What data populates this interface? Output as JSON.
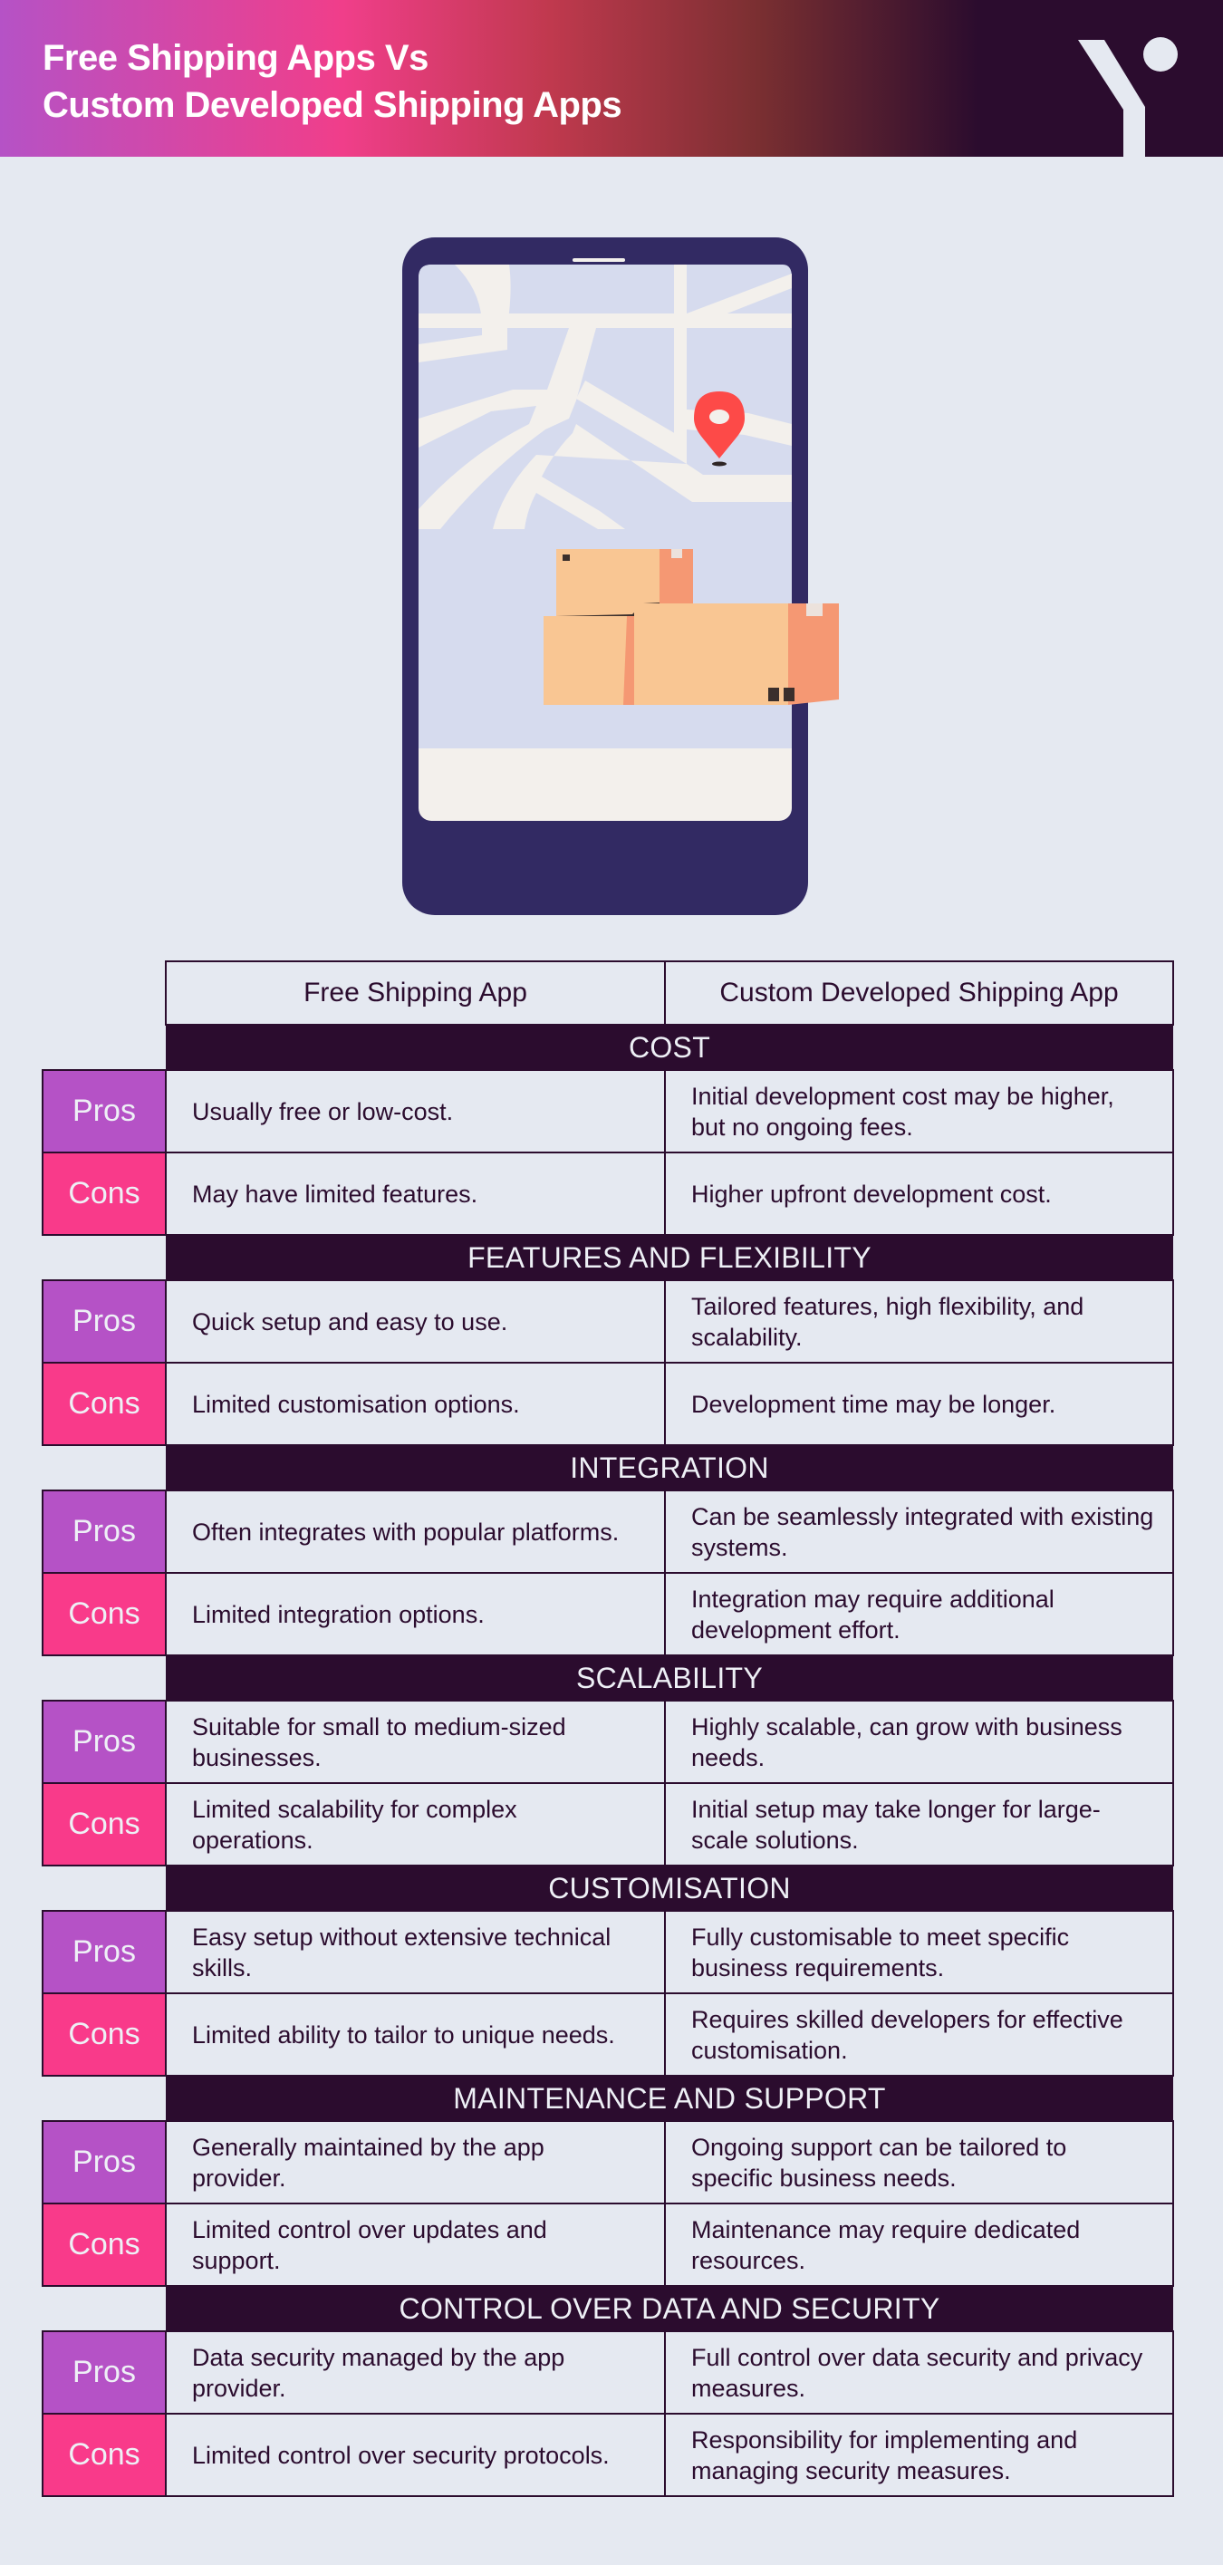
{
  "header": {
    "title_line1": "Free Shipping Apps Vs",
    "title_line2": "Custom Developed Shipping Apps",
    "logo_icon": "y-logo-mark"
  },
  "illustration": {
    "description": "smartphone-map-with-location-pin-and-parcel-boxes",
    "colors": {
      "phone": "#322a63",
      "map_bg": "#d6dbee",
      "roads": "#f3f0ec",
      "pin": "#fd4a48",
      "box_light": "#f9c693",
      "box_dark": "#f59873"
    }
  },
  "colors": {
    "pros": "#b552c6",
    "cons": "#f93a8a",
    "dark": "#2b0c2e",
    "background": "#e5e9f1"
  },
  "table": {
    "columns": [
      "Free Shipping App",
      "Custom Developed Shipping App"
    ],
    "pros_label": "Pros",
    "cons_label": "Cons",
    "sections": [
      {
        "title": "COST",
        "pros": [
          "Usually free or low-cost.",
          "Initial development cost may be higher, but no ongoing fees."
        ],
        "cons": [
          "May have limited features.",
          "Higher upfront development cost."
        ]
      },
      {
        "title": "FEATURES AND FLEXIBILITY",
        "pros": [
          "Quick setup and easy to use.",
          "Tailored features, high flexibility, and scalability."
        ],
        "cons": [
          "Limited customisation options.",
          "Development time may be longer."
        ]
      },
      {
        "title": "INTEGRATION",
        "pros": [
          "Often integrates with popular platforms.",
          "Can be seamlessly integrated with existing systems."
        ],
        "cons": [
          "Limited integration options.",
          "Integration may require additional development effort."
        ]
      },
      {
        "title": "SCALABILITY",
        "pros": [
          "Suitable for small to medium-sized businesses.",
          "Highly scalable, can grow with business needs."
        ],
        "cons": [
          "Limited scalability for complex operations.",
          "Initial setup may take longer for large-scale solutions."
        ]
      },
      {
        "title": "CUSTOMISATION",
        "pros": [
          "Easy setup without extensive technical skills.",
          "Fully customisable to meet specific business requirements."
        ],
        "cons": [
          "Limited ability to tailor to unique needs.",
          "Requires skilled developers for effective customisation."
        ]
      },
      {
        "title": "MAINTENANCE AND SUPPORT",
        "pros": [
          "Generally maintained by the app provider.",
          "Ongoing support can be tailored to specific business needs."
        ],
        "cons": [
          "Limited control over updates and support.",
          "Maintenance may require dedicated resources."
        ]
      },
      {
        "title": "CONTROL OVER DATA AND SECURITY",
        "pros": [
          "Data security managed by the app provider.",
          "Full control over data security and privacy measures."
        ],
        "cons": [
          "Limited control over security protocols.",
          "Responsibility for implementing and managing security measures."
        ]
      }
    ]
  }
}
